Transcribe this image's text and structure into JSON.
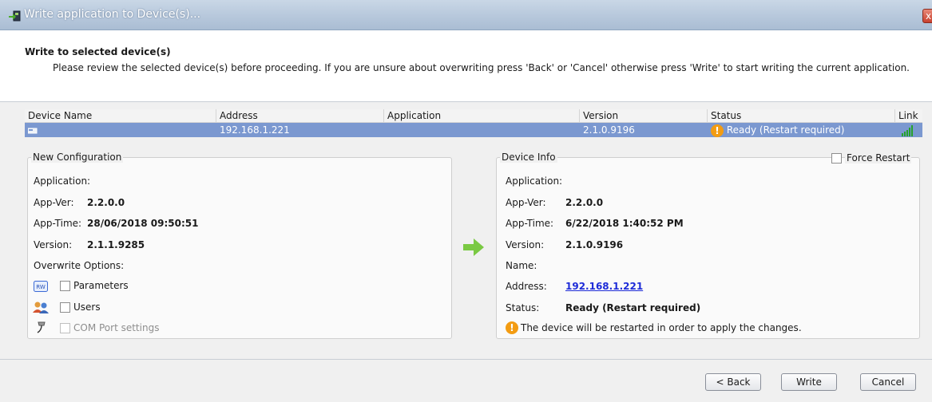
{
  "window": {
    "title": "Write application to Device(s)...",
    "close_glyph": "x",
    "icon": "write-device-icon"
  },
  "header": {
    "title": "Write to selected device(s)",
    "description": "Please review the selected device(s) before proceeding. If you are unsure about overwriting press 'Back' or 'Cancel' otherwise press 'Write' to start writing the current application."
  },
  "grid": {
    "columns": [
      "Device Name",
      "Address",
      "Application",
      "Version",
      "Status",
      "Link"
    ],
    "rows": [
      {
        "device_name": "",
        "address": "192.168.1.221",
        "application": "",
        "version": "2.1.0.9196",
        "status": "Ready (Restart required)",
        "status_icon": "warning-icon",
        "link_icon": "signal-strength-icon"
      }
    ]
  },
  "new_config": {
    "legend": "New Configuration",
    "application_label": "Application:",
    "app_ver_label": "App-Ver:",
    "app_ver": "2.2.0.0",
    "app_time_label": "App-Time:",
    "app_time": "28/06/2018 09:50:51",
    "version_label": "Version:",
    "version": "2.1.1.9285",
    "overwrite_label": "Overwrite Options:",
    "options": [
      {
        "label": "Parameters",
        "icon": "rw-parameters-icon",
        "checked": false,
        "enabled": true
      },
      {
        "label": "Users",
        "icon": "users-icon",
        "checked": false,
        "enabled": true
      },
      {
        "label": "COM Port settings",
        "icon": "com-port-icon",
        "checked": false,
        "enabled": false
      }
    ]
  },
  "arrow_icon": "right-arrow-icon",
  "device_info": {
    "legend": "Device Info",
    "force_restart_label": "Force Restart",
    "force_restart_checked": false,
    "application_label": "Application:",
    "app_ver_label": "App-Ver:",
    "app_ver": "2.2.0.0",
    "app_time_label": "App-Time:",
    "app_time": "6/22/2018 1:40:52 PM",
    "version_label": "Version:",
    "version": "2.1.0.9196",
    "name_label": "Name:",
    "address_label": "Address:",
    "address": "192.168.1.221",
    "status_label": "Status:",
    "status": "Ready (Restart required)",
    "notice": "The device will be restarted in order to apply the changes."
  },
  "footer": {
    "back_label": "< Back",
    "write_label": "Write",
    "cancel_label": "Cancel"
  },
  "colors": {
    "selection": "#7b98d0",
    "link": "#1d2bd8",
    "warning": "#f39c12",
    "arrow": "#7ac943"
  }
}
